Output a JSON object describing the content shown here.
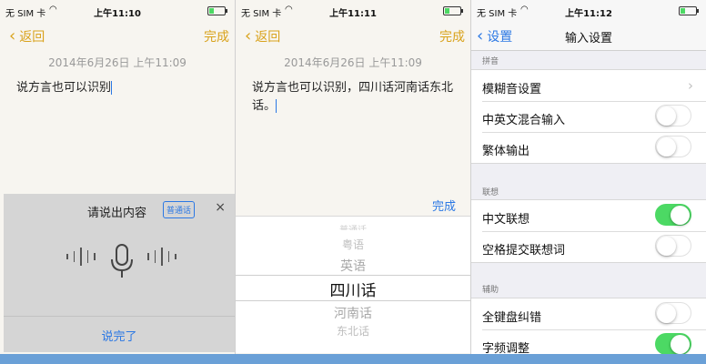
{
  "status": {
    "carrier": "无 SIM 卡",
    "screens": [
      {
        "time": "上午11:10"
      },
      {
        "time": "上午11:11"
      },
      {
        "time": "上午11:12"
      }
    ]
  },
  "notes": {
    "back_label": "返回",
    "done_label": "完成",
    "date": "2014年6月26日 上午11:09",
    "text_1": "说方言也可以识别",
    "text_2": "说方言也可以识别，四川话河南话东北话。"
  },
  "voice": {
    "prompt": "请说出内容",
    "language_badge": "普通话",
    "close_icon": "×",
    "finish_label": "说完了"
  },
  "picker": {
    "done_label": "完成",
    "options": [
      "普通话",
      "粤语",
      "英语",
      "四川话",
      "河南话",
      "东北话"
    ],
    "selected": "四川话"
  },
  "settings": {
    "back_label": "设置",
    "title": "输入设置",
    "sections": [
      {
        "header": "拼音",
        "rows": [
          {
            "label": "模糊音设置",
            "type": "arrow"
          },
          {
            "label": "中英文混合输入",
            "type": "toggle",
            "on": false
          },
          {
            "label": "繁体输出",
            "type": "toggle",
            "on": false
          }
        ]
      },
      {
        "header": "联想",
        "rows": [
          {
            "label": "中文联想",
            "type": "toggle",
            "on": true
          },
          {
            "label": "空格提交联想词",
            "type": "toggle",
            "on": false
          }
        ]
      },
      {
        "header": "辅助",
        "rows": [
          {
            "label": "全键盘纠错",
            "type": "toggle",
            "on": false
          },
          {
            "label": "字频调整",
            "type": "toggle",
            "on": true
          }
        ]
      }
    ]
  },
  "colors": {
    "notes_accent": "#d9a21b",
    "ios_blue": "#2b78e4",
    "toggle_on": "#4cd964"
  }
}
